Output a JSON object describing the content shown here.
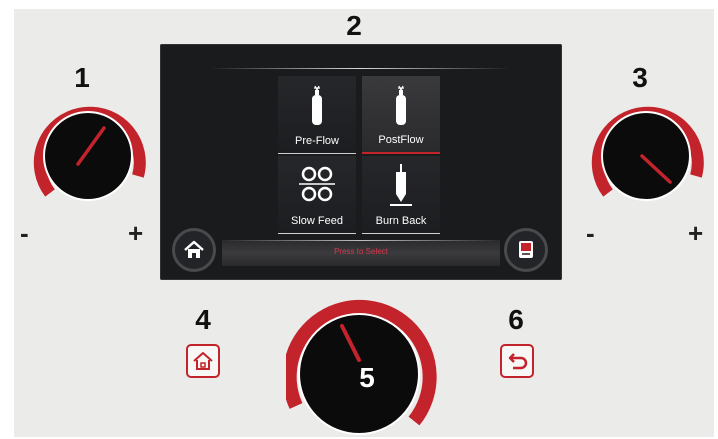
{
  "labels": {
    "knob_left": "1",
    "screen": "2",
    "knob_right": "3",
    "home_button": "4",
    "main_knob": "5",
    "back_button": "6"
  },
  "signs": {
    "minus": "-",
    "plus": "+"
  },
  "screen": {
    "tiles": [
      {
        "label": "Pre-Flow",
        "icon": "gas-cylinder-icon",
        "selected": false
      },
      {
        "label": "PostFlow",
        "icon": "gas-cylinder-icon",
        "selected": true
      },
      {
        "label": "Slow Feed",
        "icon": "wire-spools-icon",
        "selected": false
      },
      {
        "label": "Burn Back",
        "icon": "torch-icon",
        "selected": false
      }
    ],
    "status": "Press to Select"
  },
  "colors": {
    "accent_red": "#c3232a",
    "knob_black": "#0b0b0b",
    "panel_bg": "#ebebe9",
    "screen_bg": "#1a1b1d"
  }
}
